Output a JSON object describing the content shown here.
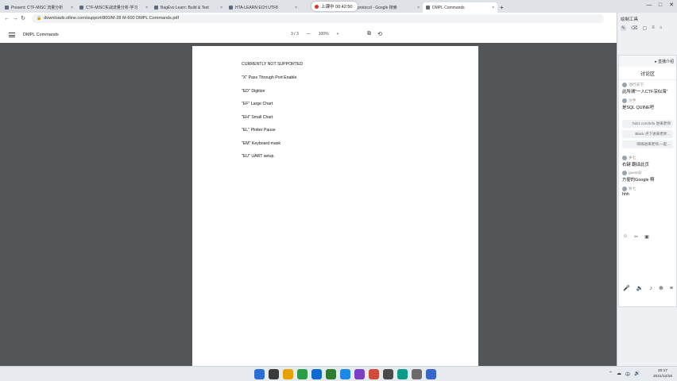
{
  "browser": {
    "tabs": [
      {
        "label": "Present: CTF-MISC 流量分析",
        "close": "×"
      },
      {
        "label": "CTF-MISC实战流量分析-学习",
        "close": "×"
      },
      {
        "label": "BagEvo Learn: Build & Test",
        "close": "×"
      },
      {
        "label": "HTA-LEARN ECH UTF8",
        "close": "×"
      },
      {
        "label": "protocol - Google 搜索",
        "close": "×"
      },
      {
        "label": "DMPL Commands",
        "close": "×"
      }
    ],
    "active_tab": 5,
    "new_tab": "+",
    "live_indicator": "上课中 00:42:50",
    "url": "downloads.olline.com/support/800/M-28 M-600 DMPL Commands.pdf",
    "window_controls": [
      "—",
      "□",
      "✕"
    ]
  },
  "pdf_toolbar": {
    "title": "DMPL Commands",
    "page_current": "3",
    "page_sep": "/",
    "page_total": "3",
    "zoom_out": "—",
    "zoom": "100%",
    "zoom_in": "+"
  },
  "pdf_page": {
    "lines": [
      "CURRENTLY NOT SUPPORTED",
      "\"X\"  Pass Through Port Enable",
      "\"ED\" Digitize",
      "\"EF\"  Large Chart",
      "\"EH\"  Small Chart",
      "\"EL\"  Plotter Pause",
      "\"EM\"  Keyboard mask",
      "\"EU\"  UART setup."
    ]
  },
  "right_panel": {
    "header": "绘制工具",
    "tools": [
      "✎",
      "⌫",
      "▢",
      "≡",
      "⌂"
    ],
    "chat": {
      "top_link": "▸ 直播介绍",
      "title": "讨论区",
      "messages": [
        {
          "user": "池行天下",
          "text": "此所谓\"一入CTF深似海\""
        },
        {
          "user": "沙手",
          "text": "是SQL QUINE吧"
        }
      ],
      "system_notes": [
        "hdzz.com/info 进来老师",
        "Black 点下进来老师…",
        "嗨嗨进来老师,一起…"
      ],
      "messages_after": [
        {
          "user": "岁七",
          "text": "右键 翻译此页"
        },
        {
          "user": "guest@",
          "text": "方便的Google 啊"
        },
        {
          "user": "岁七",
          "text": "hhh"
        }
      ],
      "icons": [
        "☺",
        "✂",
        "▣"
      ],
      "bottom_icons": [
        "🎤",
        "🔈",
        "♪",
        "⊕",
        "≡"
      ]
    }
  },
  "taskbar": {
    "icon_colors": [
      "#2b6fd6",
      "#3a3a3a",
      "#e8a200",
      "#2a9d46",
      "#0b6bd1",
      "#2f7d32",
      "#1e88e5",
      "#7a3fc4",
      "#d14b3a",
      "#4a4a4a",
      "#0c9a8a",
      "#6b6b6b",
      "#3567c9"
    ],
    "tray": [
      "⌃",
      "☁",
      "中",
      "🔊",
      "⌨"
    ],
    "time": "20:17",
    "date": "2021/12/16"
  }
}
